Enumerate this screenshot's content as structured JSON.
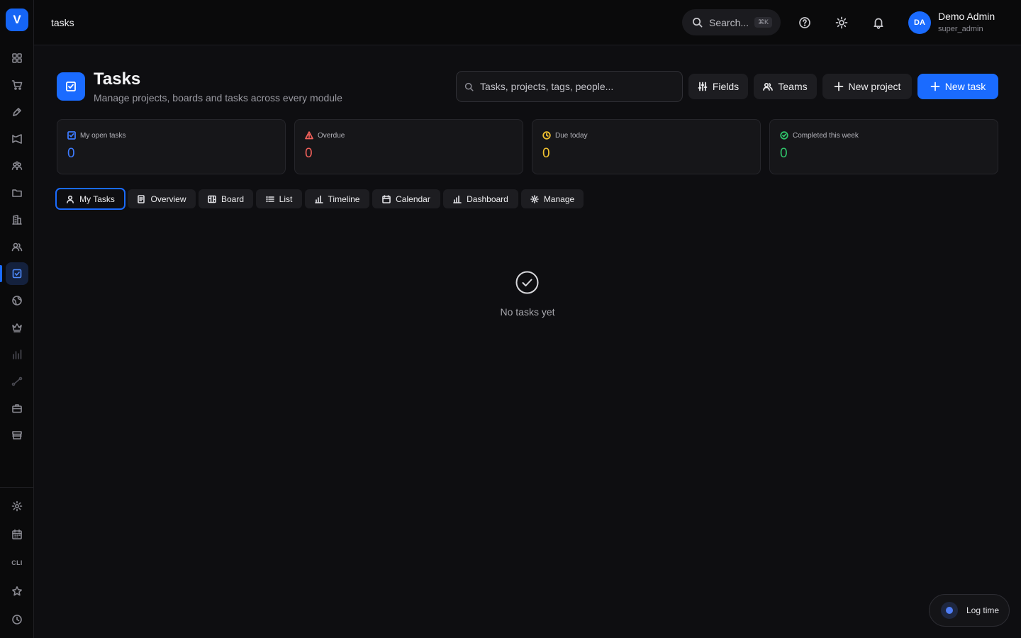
{
  "app": {
    "logo_letter": "V"
  },
  "topbar": {
    "breadcrumb": "tasks",
    "search_placeholder": "Search...",
    "search_shortcut": "⌘K",
    "user": {
      "initials": "DA",
      "name": "Demo Admin",
      "role": "super_admin"
    }
  },
  "sidebar": {
    "icons": [
      "grid-icon",
      "cart-icon",
      "pen-icon",
      "megaphone-icon",
      "people-icon",
      "folder-icon",
      "building-icon",
      "users-icon",
      "tasks-icon",
      "globe-icon",
      "crown-icon",
      "chart-icon",
      "route-icon",
      "briefcase-icon",
      "store-icon"
    ],
    "active": "tasks-icon",
    "bottom": [
      "gear-icon",
      "calendar-icon",
      "cli-label",
      "star-icon",
      "clock-icon"
    ],
    "cli_label": "CLI"
  },
  "header": {
    "title": "Tasks",
    "subtitle": "Manage projects, boards and tasks across every module",
    "search_placeholder": "Tasks, projects, tags, people...",
    "buttons": {
      "fields": "Fields",
      "teams": "Teams",
      "new_project": "New project",
      "new_task": "New task"
    }
  },
  "stats": [
    {
      "label": "My open tasks",
      "value": "0",
      "color": "#3d7bff"
    },
    {
      "label": "Overdue",
      "value": "0",
      "color": "#f0605a"
    },
    {
      "label": "Due today",
      "value": "0",
      "color": "#f2c230"
    },
    {
      "label": "Completed this week",
      "value": "0",
      "color": "#2fc46a"
    }
  ],
  "tabs": [
    {
      "label": "My Tasks",
      "active": true
    },
    {
      "label": "Overview"
    },
    {
      "label": "Board"
    },
    {
      "label": "List"
    },
    {
      "label": "Timeline"
    },
    {
      "label": "Calendar"
    },
    {
      "label": "Dashboard"
    },
    {
      "label": "Manage"
    }
  ],
  "empty_state": {
    "text": "No tasks yet"
  },
  "log_time": {
    "label": "Log time"
  },
  "colors": {
    "accent": "#1a6bff",
    "background": "#0e0e11",
    "panel": "#161619"
  }
}
